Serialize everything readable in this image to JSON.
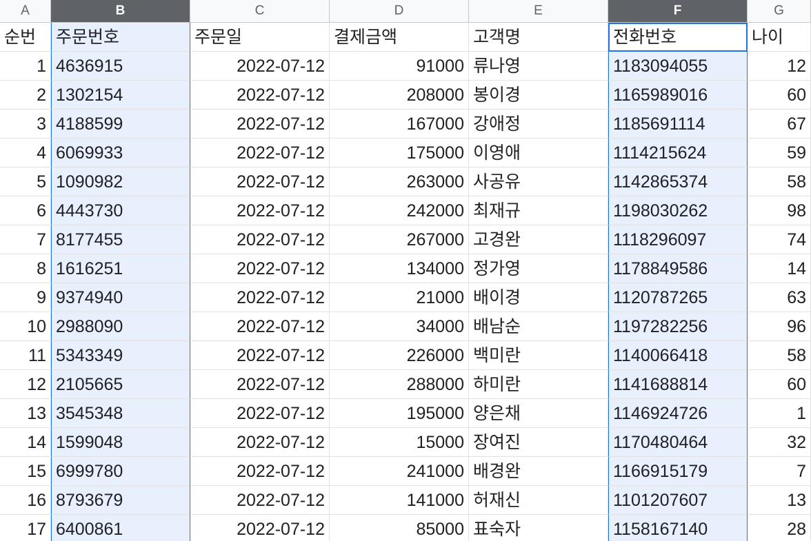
{
  "columns": [
    "A",
    "B",
    "C",
    "D",
    "E",
    "F",
    "G"
  ],
  "selected_columns": [
    "B",
    "F"
  ],
  "active_cell": "F1",
  "headers": [
    "순번",
    "주문번호",
    "주문일",
    "결제금액",
    "고객명",
    "전화번호",
    "나이"
  ],
  "rows": [
    [
      "1",
      "4636915",
      "2022-07-12",
      "91000",
      "류나영",
      "1183094055",
      "12"
    ],
    [
      "2",
      "1302154",
      "2022-07-12",
      "208000",
      "봉이경",
      "1165989016",
      "60"
    ],
    [
      "3",
      "4188599",
      "2022-07-12",
      "167000",
      "강애정",
      "1185691114",
      "67"
    ],
    [
      "4",
      "6069933",
      "2022-07-12",
      "175000",
      "이영애",
      "1114215624",
      "59"
    ],
    [
      "5",
      "1090982",
      "2022-07-12",
      "263000",
      "사공유",
      "1142865374",
      "58"
    ],
    [
      "6",
      "4443730",
      "2022-07-12",
      "242000",
      "최재규",
      "1198030262",
      "98"
    ],
    [
      "7",
      "8177455",
      "2022-07-12",
      "267000",
      "고경완",
      "1118296097",
      "74"
    ],
    [
      "8",
      "1616251",
      "2022-07-12",
      "134000",
      "정가영",
      "1178849586",
      "14"
    ],
    [
      "9",
      "9374940",
      "2022-07-12",
      "21000",
      "배이경",
      "1120787265",
      "63"
    ],
    [
      "10",
      "2988090",
      "2022-07-12",
      "34000",
      "배남순",
      "1197282256",
      "96"
    ],
    [
      "11",
      "5343349",
      "2022-07-12",
      "226000",
      "백미란",
      "1140066418",
      "58"
    ],
    [
      "12",
      "2105665",
      "2022-07-12",
      "288000",
      "하미란",
      "1141688814",
      "60"
    ],
    [
      "13",
      "3545348",
      "2022-07-12",
      "195000",
      "양은채",
      "1146924726",
      "1"
    ],
    [
      "14",
      "1599048",
      "2022-07-12",
      "15000",
      "장여진",
      "1170480464",
      "32"
    ],
    [
      "15",
      "6999780",
      "2022-07-12",
      "241000",
      "배경완",
      "1166915179",
      "7"
    ],
    [
      "16",
      "8793679",
      "2022-07-12",
      "141000",
      "허재신",
      "1101207607",
      "13"
    ],
    [
      "17",
      "6400861",
      "2022-07-12",
      "85000",
      "표숙자",
      "1158167140",
      "28"
    ]
  ],
  "colors": {
    "selection_fill": "#e8f0fe",
    "selection_border": "#1a73e8",
    "selected_header": "#5f6368"
  }
}
